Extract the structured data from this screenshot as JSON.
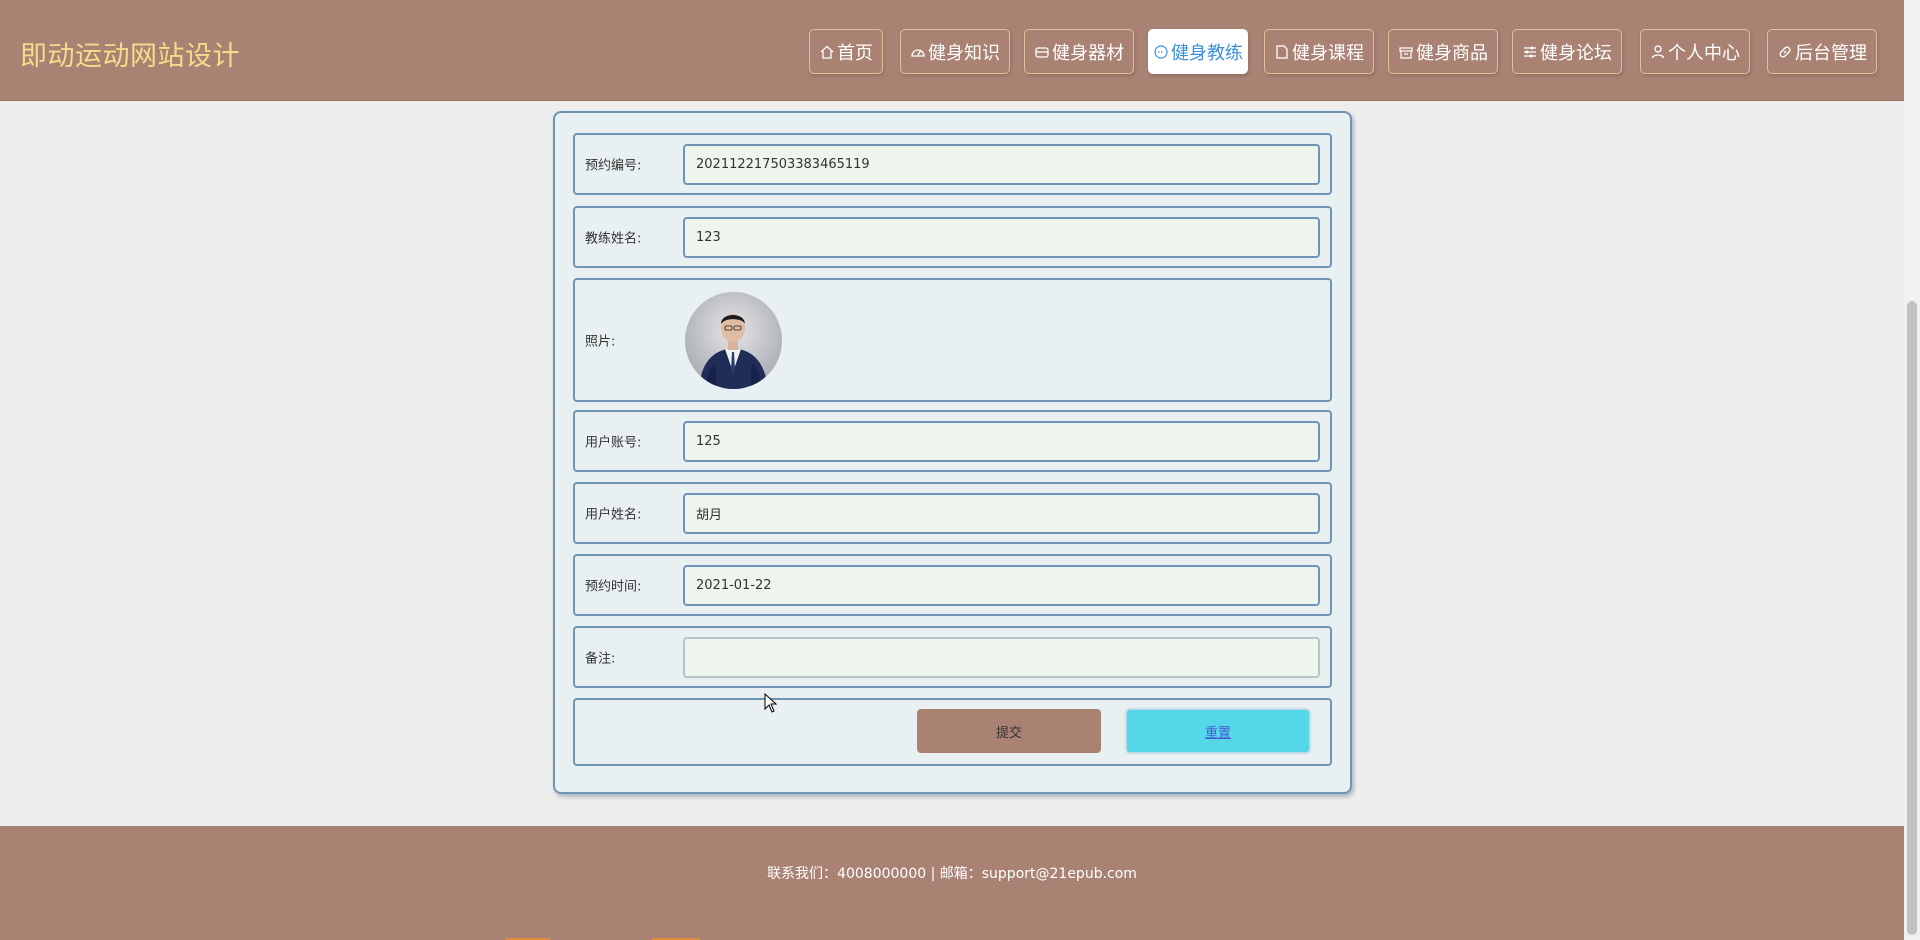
{
  "header": {
    "site_title": "即动运动网站设计",
    "nav": [
      {
        "label": "首页",
        "icon": "home-icon",
        "active": false
      },
      {
        "label": "健身知识",
        "icon": "gauge-icon",
        "active": false
      },
      {
        "label": "健身器材",
        "icon": "equipment-icon",
        "active": false
      },
      {
        "label": "健身教练",
        "icon": "circle-dots-icon",
        "active": true
      },
      {
        "label": "健身课程",
        "icon": "document-icon",
        "active": false
      },
      {
        "label": "健身商品",
        "icon": "shop-icon",
        "active": false
      },
      {
        "label": "健身论坛",
        "icon": "sliders-icon",
        "active": false
      },
      {
        "label": "个人中心",
        "icon": "user-icon",
        "active": false
      },
      {
        "label": "后台管理",
        "icon": "link-icon",
        "active": false
      }
    ]
  },
  "form": {
    "booking_no": {
      "label": "预约编号:",
      "value": "202112217503383465119"
    },
    "coach_name": {
      "label": "教练姓名:",
      "value": "123"
    },
    "photo": {
      "label": "照片:"
    },
    "user_account": {
      "label": "用户账号:",
      "value": "125"
    },
    "user_name": {
      "label": "用户姓名:",
      "value": "胡月"
    },
    "booking_time": {
      "label": "预约时间:",
      "value": "2021-01-22"
    },
    "remark": {
      "label": "备注:",
      "value": ""
    },
    "submit_label": "提交",
    "reset_label": "重置"
  },
  "footer": {
    "text": "联系我们：4008000000 | 邮箱：support@21epub.com"
  },
  "colors": {
    "header_bg": "#a98274",
    "title": "#f2dd8a",
    "active_nav_text": "#3d8fd6",
    "card_border": "#6f95b6",
    "input_bg": "#edf5ec",
    "reset_bg": "#55d7ea"
  }
}
